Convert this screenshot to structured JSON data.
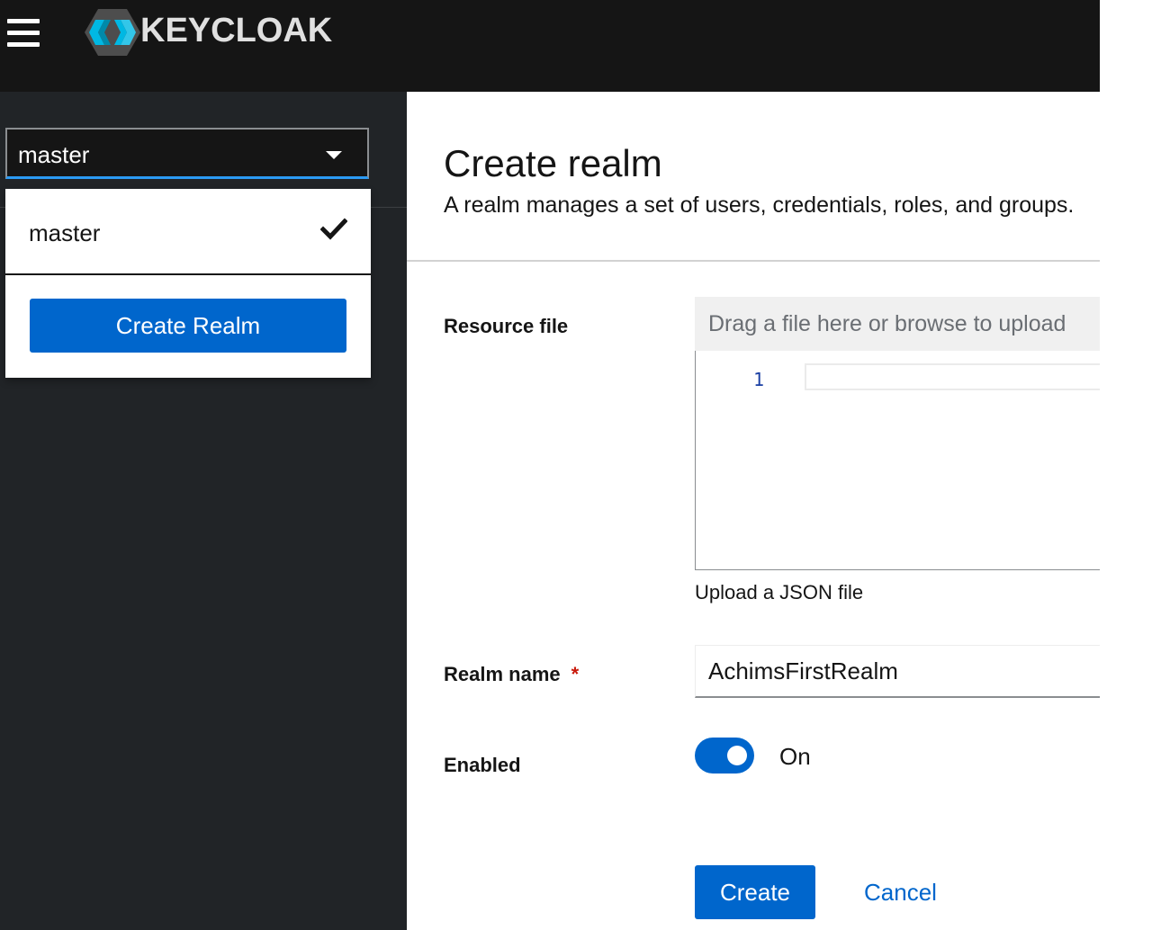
{
  "header": {
    "menu_icon": "hamburger-icon",
    "logo_icon": "keycloak-logo-icon",
    "brand": "KEYCLOAK"
  },
  "sidebar": {
    "realm_selector": {
      "selected": "master",
      "caret_icon": "caret-down-icon"
    },
    "dropdown": {
      "items": [
        {
          "label": "master",
          "icon": "check-icon",
          "selected": true
        }
      ],
      "create_realm_label": "Create Realm"
    }
  },
  "main": {
    "title": "Create realm",
    "description": "A realm manages a set of users, credentials, roles, and groups.",
    "form": {
      "resource_file": {
        "label": "Resource file",
        "placeholder": "Drag a file here or browse to upload",
        "editor_line_number": "1",
        "helper": "Upload a JSON file"
      },
      "realm_name": {
        "label": "Realm name",
        "required_marker": "*",
        "value": "AchimsFirstRealm"
      },
      "enabled": {
        "label": "Enabled",
        "state_label": "On",
        "checked": true
      }
    },
    "actions": {
      "create_label": "Create",
      "cancel_label": "Cancel"
    }
  },
  "colors": {
    "masthead": "#151515",
    "sidebar": "#212427",
    "primary": "#0066cc",
    "select_underline": "#2b9af3",
    "required": "#c9190b"
  }
}
